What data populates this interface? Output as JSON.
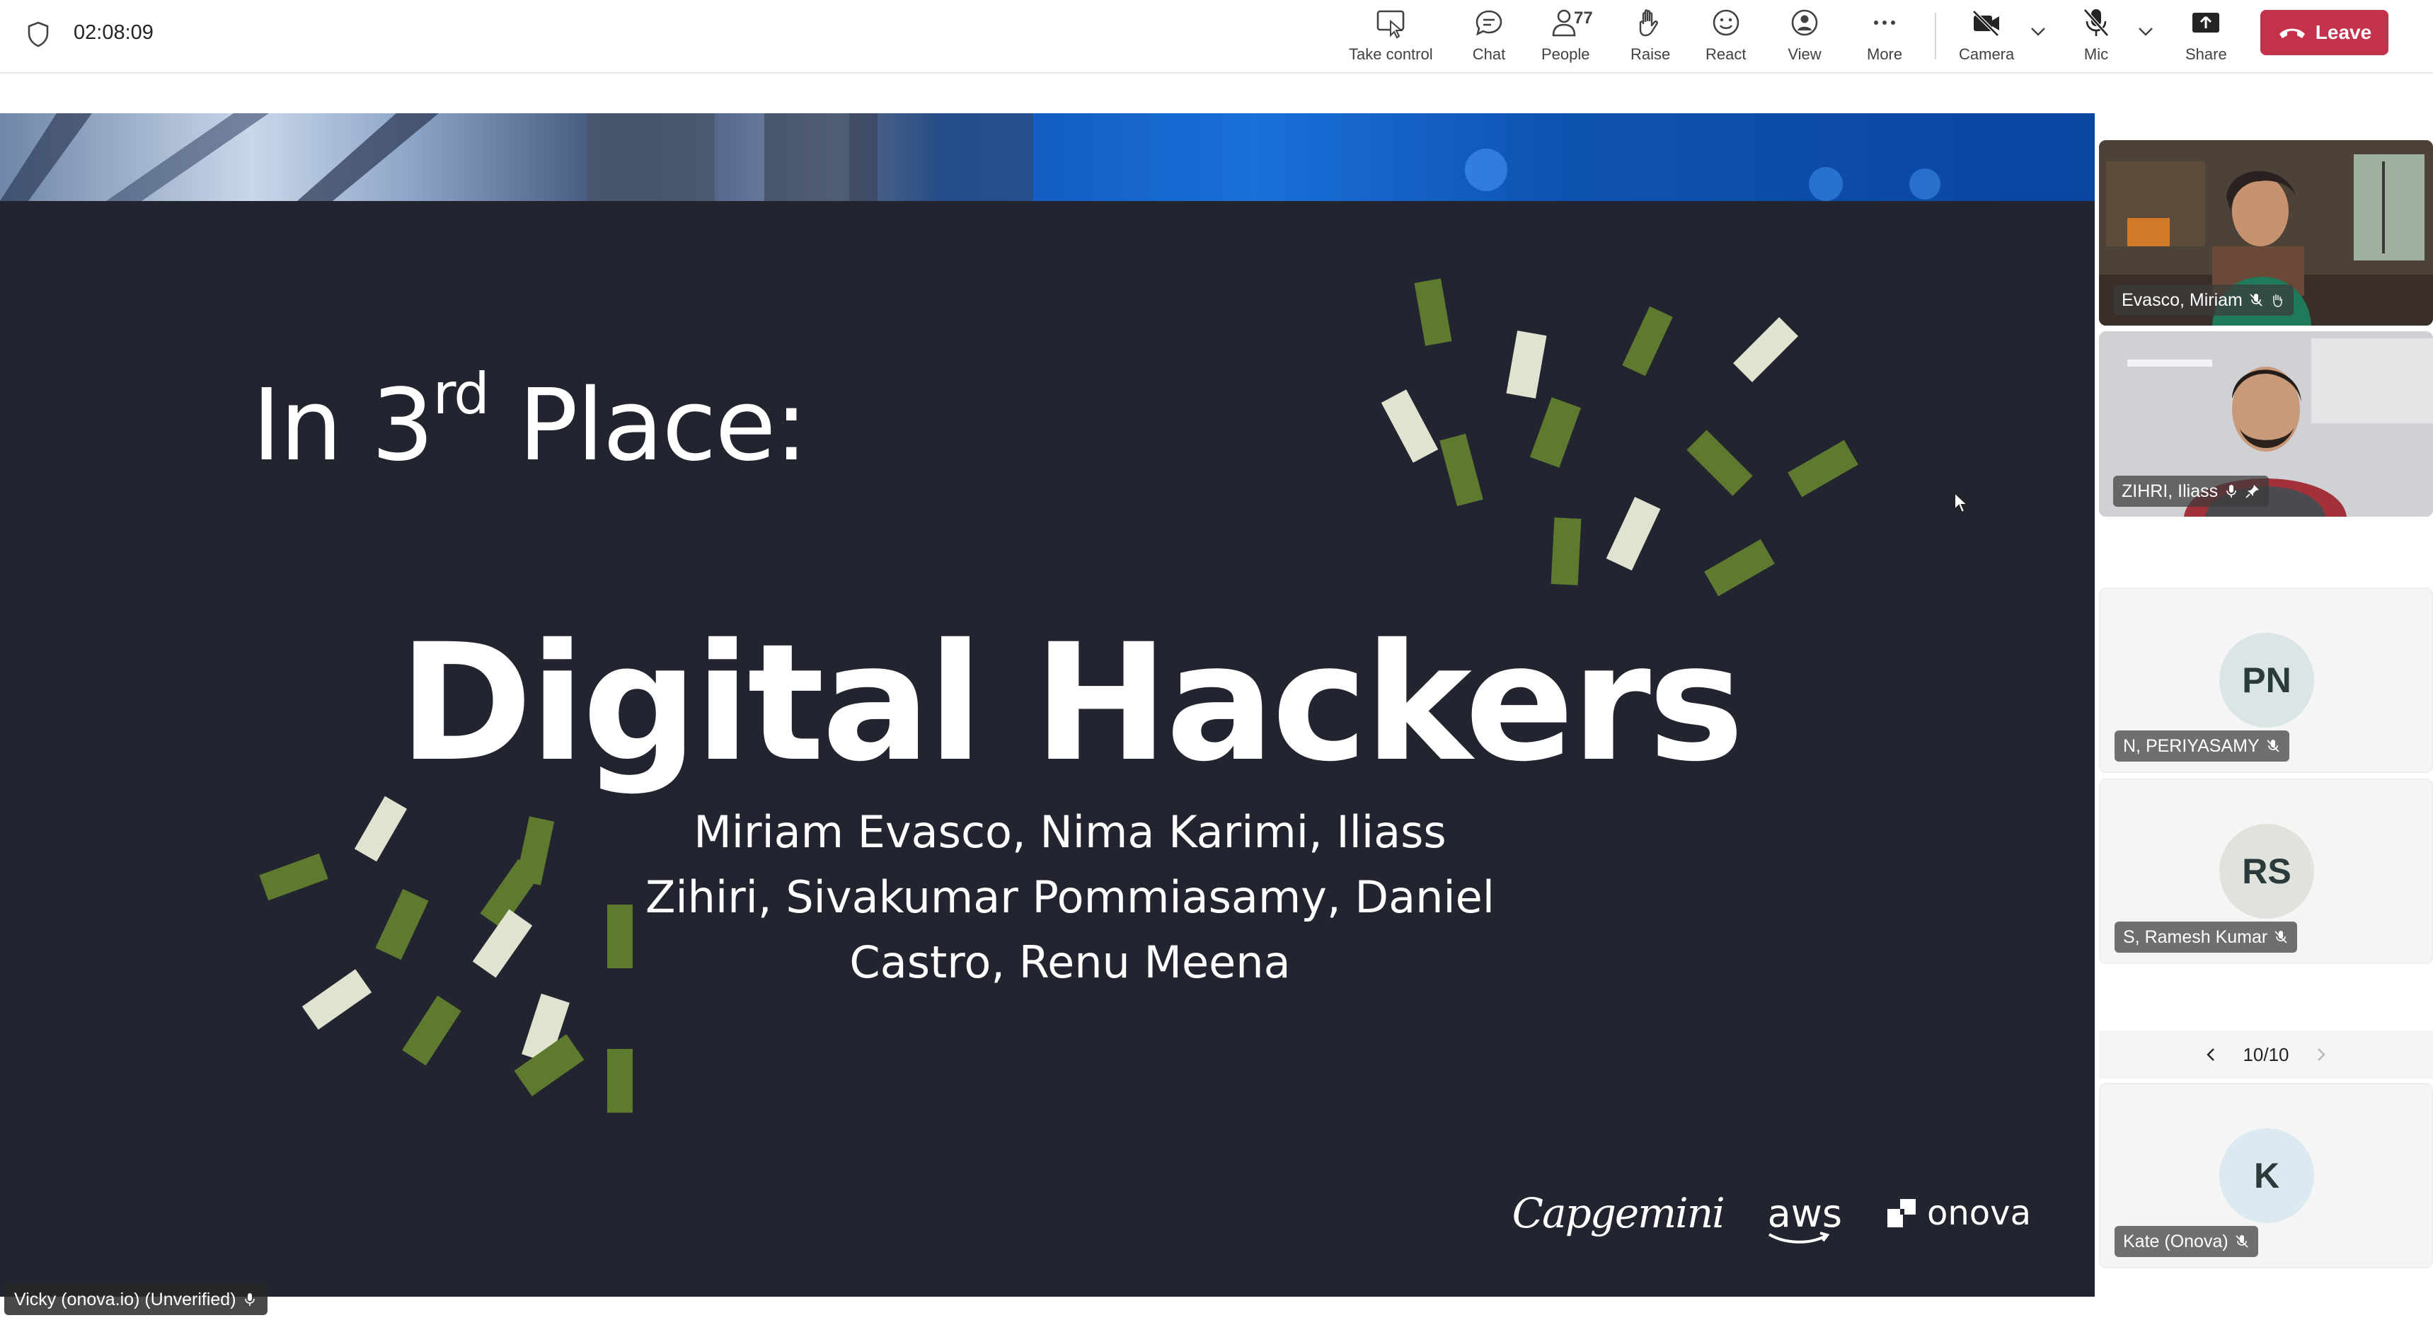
{
  "call": {
    "timer": "02:08:09",
    "people_count": "77"
  },
  "toolbar": {
    "take_control": "Take control",
    "chat": "Chat",
    "people": "People",
    "raise": "Raise",
    "react": "React",
    "view": "View",
    "more": "More",
    "camera": "Camera",
    "mic": "Mic",
    "share": "Share",
    "leave": "Leave"
  },
  "slide": {
    "heading_prefix": "In 3",
    "heading_sup": "rd",
    "heading_suffix": " Place:",
    "team_name": "Digital Hackers",
    "members_line1": "Miriam Evasco, Nima Karimi, Iliass",
    "members_line2": "Zihiri, Sivakumar Pommiasamy, Daniel",
    "members_line3": "Castro, Renu Meena",
    "logo_capgemini": "Capgemini",
    "logo_aws": "aws",
    "logo_onova": "onova"
  },
  "presenter": {
    "name": "Vicky (onova.io) (Unverified)"
  },
  "participants": {
    "video": [
      {
        "name": "Evasco, Miriam"
      },
      {
        "name": "ZIHRI, Iliass"
      }
    ],
    "tiles": [
      {
        "initials": "PN",
        "name": "N, PERIYASAMY",
        "avatar_color": "#dbe5e6"
      },
      {
        "initials": "RS",
        "name": "S, Ramesh Kumar",
        "avatar_color": "#e0e3dc"
      },
      {
        "initials": "K",
        "name": "Kate (Onova)",
        "avatar_color": "#dbeaf0"
      }
    ],
    "pager": "10/10"
  },
  "colors": {
    "leave": "#c4314b",
    "stage_bg": "#222430",
    "confetti_green": "#5d7a2e",
    "confetti_light": "#dfe3d0"
  }
}
